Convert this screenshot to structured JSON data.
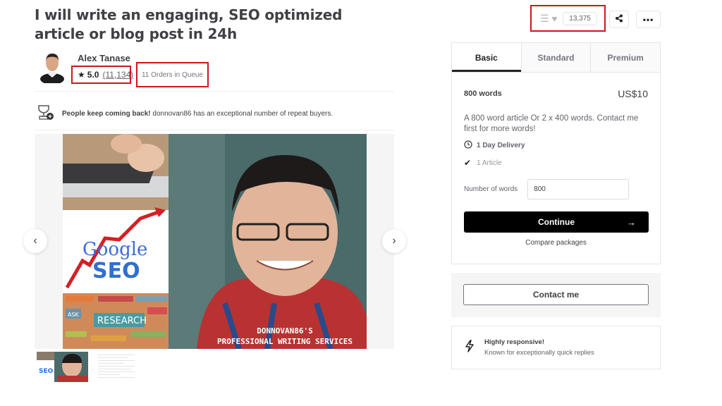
{
  "gig": {
    "title": "I will write an engaging, SEO optimized article or blog post in 24h"
  },
  "seller": {
    "name": "Alex Tanase",
    "rating": "5.0",
    "review_count": "(11,134)",
    "orders_in_queue": "11 Orders in Queue"
  },
  "repeat_banner": {
    "bold": "People keep coming back!",
    "text": " donnovan86 has an exceptional number of repeat buyers."
  },
  "gallery": {
    "overlay_line1": "DONNOVAN86'S",
    "overlay_line2": "PROFESSIONAL WRITING SERVICES",
    "seo_text": "SEO",
    "google_text": "Google",
    "research_text": "RESEARCH",
    "ask_text": "ASK"
  },
  "actions": {
    "favorites_count": "13,375"
  },
  "packages": {
    "tabs": [
      {
        "label": "Basic",
        "active": true
      },
      {
        "label": "Standard",
        "active": false
      },
      {
        "label": "Premium",
        "active": false
      }
    ],
    "selected": {
      "name": "800 words",
      "price": "US$10",
      "description": "A 800 word article Or 2 x 400 words. Contact me first for more words!",
      "delivery": "1 Day Delivery",
      "features": [
        "1 Article"
      ]
    },
    "words_label": "Number of words",
    "words_value": "800",
    "continue_label": "Continue",
    "compare_label": "Compare packages"
  },
  "contact": {
    "label": "Contact me"
  },
  "responsive": {
    "title": "Highly responsive!",
    "subtitle": "Known for exceptionally quick replies"
  },
  "colors": {
    "highlight_border": "#d0151c",
    "primary_button": "#000000"
  }
}
